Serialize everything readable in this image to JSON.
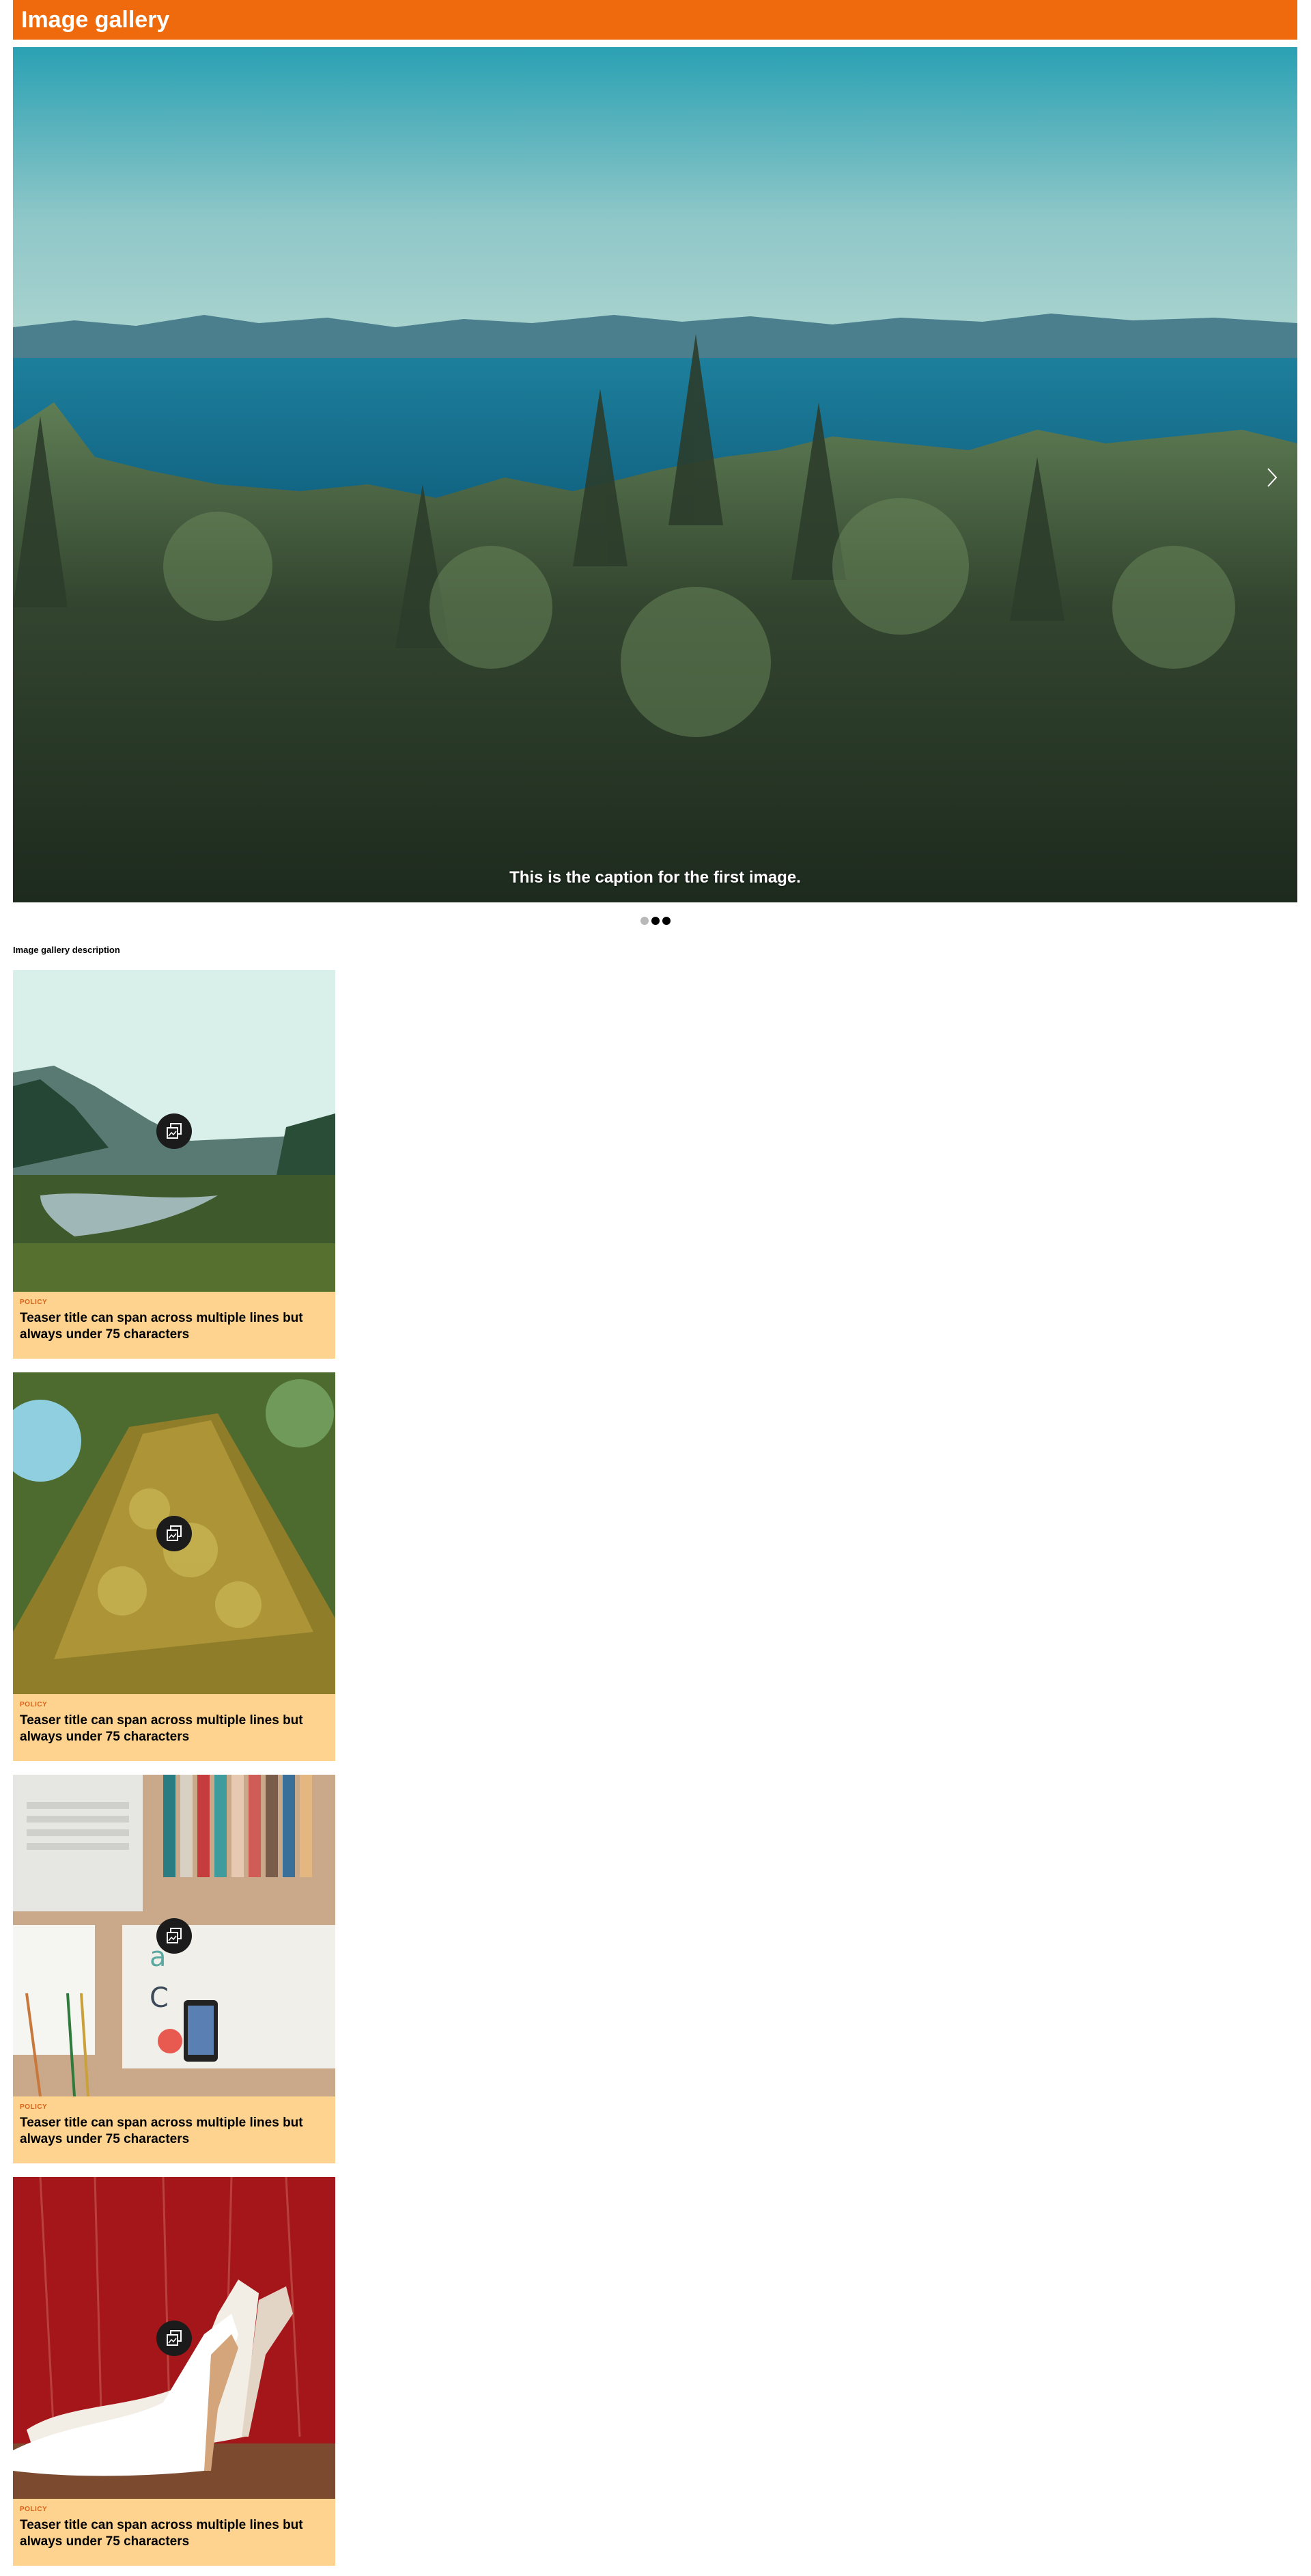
{
  "header": {
    "title": "Image gallery"
  },
  "slider": {
    "caption": "This is the caption for the first image.",
    "next_icon": "chevron-right-icon",
    "dots": [
      {
        "active": false
      },
      {
        "active": true
      },
      {
        "active": true
      }
    ]
  },
  "description": "Image gallery description",
  "cards": [
    {
      "category": "POLICY",
      "title": "Teaser title can span across multiple lines but always under 75 characters",
      "image": "misty-valley-river",
      "icon": "gallery-icon"
    },
    {
      "category": "POLICY",
      "title": "Teaser title can span across multiple lines but always under 75 characters",
      "image": "mossy-tree-trunk",
      "icon": "gallery-icon"
    },
    {
      "category": "POLICY",
      "title": "Teaser title can span across multiple lines but always under 75 characters",
      "image": "desk-with-laptop-and-books",
      "icon": "gallery-icon"
    },
    {
      "category": "POLICY",
      "title": "Teaser title can span across multiple lines but always under 75 characters",
      "image": "white-high-heels-red-wall",
      "icon": "gallery-icon"
    }
  ],
  "colors": {
    "header": "#ee6a0c",
    "card_footer": "#fed28f",
    "category": "#d8641a"
  }
}
